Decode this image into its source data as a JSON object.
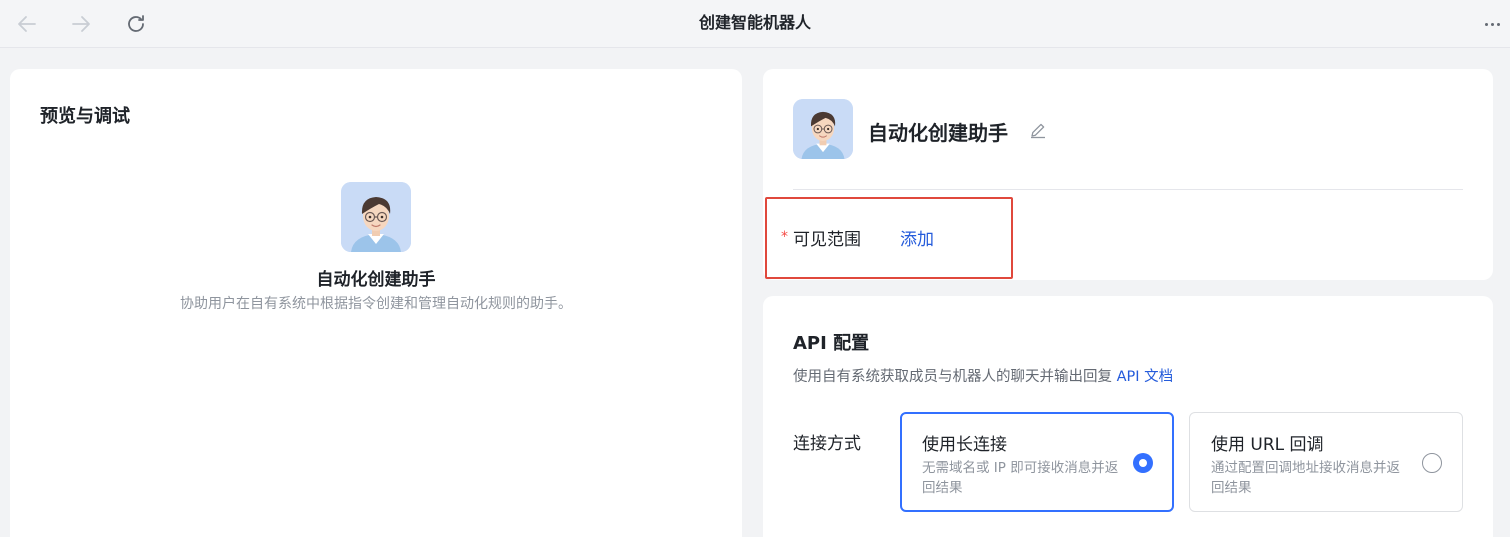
{
  "window": {
    "title": "创建智能机器人",
    "nav": {
      "back_icon": "arrow-left-icon",
      "forward_icon": "arrow-right-icon",
      "reload_icon": "reload-icon",
      "more_icon": "more-dots-icon"
    }
  },
  "preview": {
    "title": "预览与调试",
    "bot_name": "自动化创建助手",
    "bot_description": "协助用户在自有系统中根据指令创建和管理自动化规则的助手。",
    "avatar_icon": "bot-avatar-icon"
  },
  "profile": {
    "bot_name": "自动化创建助手",
    "edit_icon": "edit-pencil-icon",
    "visibility": {
      "required_mark": "*",
      "label": "可见范围",
      "add_label": "添加"
    }
  },
  "api": {
    "title": "API 配置",
    "description": "使用自有系统获取成员与机器人的聊天并输出回复",
    "doc_link": "API 文档",
    "connection_label": "连接方式",
    "options": [
      {
        "title": "使用长连接",
        "desc": "无需域名或 IP 即可接收消息并返回结果",
        "selected": true
      },
      {
        "title": "使用 URL 回调",
        "desc": "通过配置回调地址接收消息并返回结果",
        "selected": false
      }
    ]
  },
  "colors": {
    "accent": "#3370ff",
    "link": "#245bdb",
    "highlight_border": "#e0483c",
    "required": "#f54a45"
  }
}
